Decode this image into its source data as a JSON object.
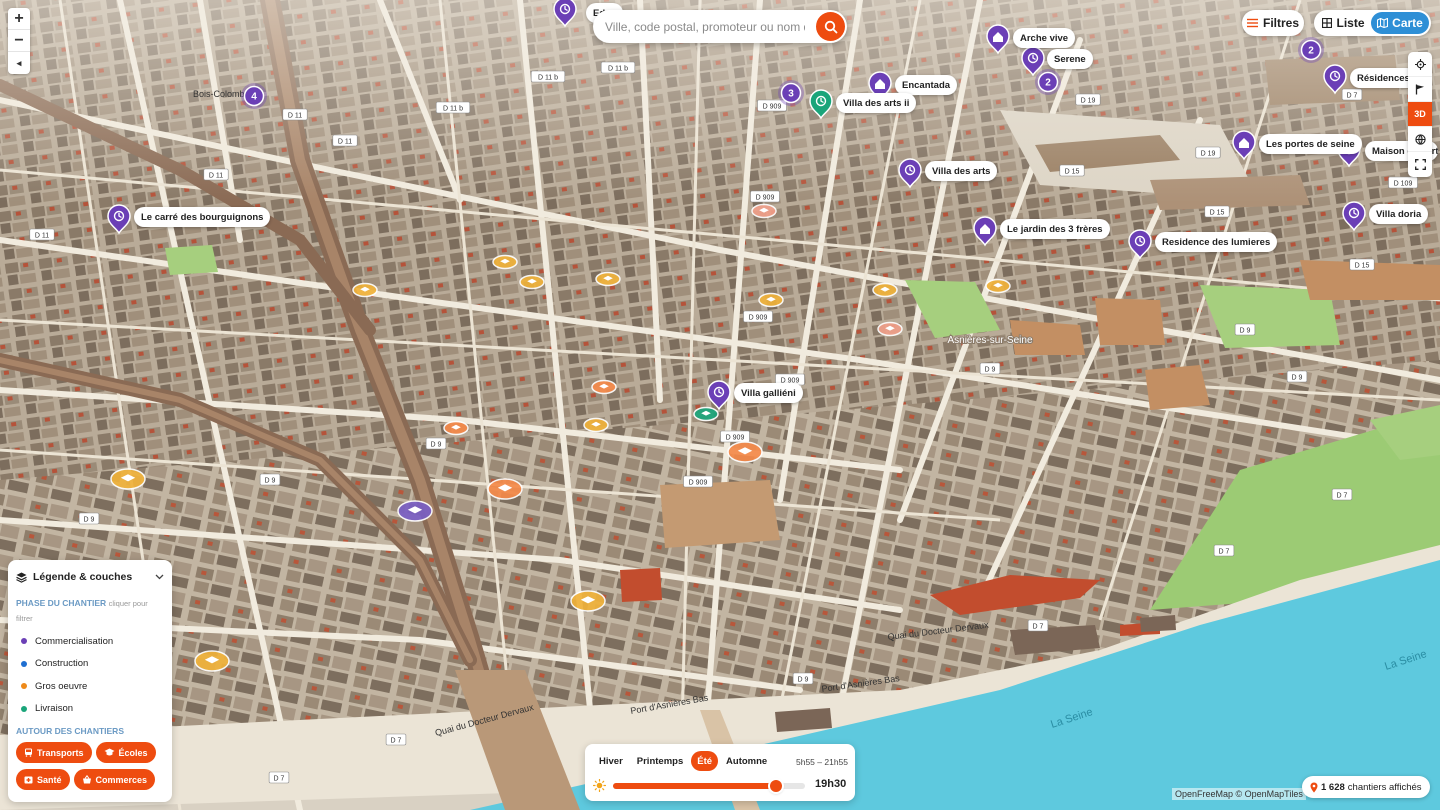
{
  "map": {
    "search_placeholder": "Ville, code postal, promoteur ou nom de chantier",
    "attribution": "OpenFreeMap © OpenMapTiles",
    "place_labels": [
      "Asnières-sur-Seine",
      "Bois-Colombes",
      "La Seine",
      "La Seine"
    ],
    "road_labels": [
      "D 11",
      "D 11",
      "D 11",
      "D 11",
      "D 11 b",
      "D 11 b",
      "D 909",
      "D 909",
      "D 909",
      "D 909",
      "D 909",
      "D 9",
      "D 9",
      "D 9",
      "D 9",
      "D 9",
      "D 7",
      "D 7",
      "D 7",
      "D 7",
      "D 7",
      "D 7",
      "D 15",
      "D 15",
      "D 15",
      "D 19",
      "D 19",
      "D 109",
      "Quai du Docteur Dervaux",
      "Quai du Docteur Dervaux",
      "Port d'Asnières Bas",
      "Port d'Asnières Bas"
    ],
    "pins": [
      {
        "label": "Eden",
        "color": "#6b3fb6",
        "icon": "clock-icon"
      },
      {
        "label": "Arche vive",
        "color": "#6b3fb6",
        "icon": "home-icon"
      },
      {
        "label": "Serene",
        "color": "#6b3fb6",
        "icon": "clock-icon"
      },
      {
        "label": "Encantada",
        "color": "#6b3fb6",
        "icon": "home-icon"
      },
      {
        "label": "Villa des arts ii",
        "color": "#1aa57a",
        "icon": "clock-icon"
      },
      {
        "label": "Résidences",
        "color": "#6b3fb6",
        "icon": "clock-icon"
      },
      {
        "label": "Les portes de seine",
        "color": "#6b3fb6",
        "icon": "home-icon"
      },
      {
        "label": "Maison des arts",
        "color": "#6b3fb6",
        "icon": "clock-icon"
      },
      {
        "label": "Villa des arts",
        "color": "#6b3fb6",
        "icon": "clock-icon"
      },
      {
        "label": "Le carré des bourguignons",
        "color": "#6b3fb6",
        "icon": "clock-icon"
      },
      {
        "label": "Le jardin des 3 frères",
        "color": "#6b3fb6",
        "icon": "home-icon"
      },
      {
        "label": "Residence des lumieres",
        "color": "#6b3fb6",
        "icon": "clock-icon"
      },
      {
        "label": "Villa doria",
        "color": "#6b3fb6",
        "icon": "clock-icon"
      },
      {
        "label": "Villa galliéni",
        "color": "#6b3fb6",
        "icon": "clock-icon"
      }
    ],
    "clusters": [
      "4",
      "3",
      "2",
      "2"
    ]
  },
  "controls": {
    "zoom_in": "+",
    "zoom_out": "−",
    "compass": "◂",
    "filters_label": "Filtres",
    "list_label": "Liste",
    "map_label": "Carte",
    "mode_3d_label": "3D"
  },
  "legend": {
    "title": "Légende & couches",
    "phase_title": "PHASE DU CHANTIER",
    "phase_hint": "cliquer pour filtrer",
    "phases": [
      {
        "label": "Commercialisation",
        "color": "#6b3fb6"
      },
      {
        "label": "Construction",
        "color": "#1f6fd1"
      },
      {
        "label": "Gros oeuvre",
        "color": "#ee8a1a"
      },
      {
        "label": "Livraison",
        "color": "#1aa57a"
      }
    ],
    "around_title": "AUTOUR DES CHANTIERS",
    "chips": [
      {
        "label": "Transports",
        "icon": "bus-icon"
      },
      {
        "label": "Écoles",
        "icon": "graduation-cap-icon"
      },
      {
        "label": "Santé",
        "icon": "medical-icon"
      },
      {
        "label": "Commerces",
        "icon": "basket-icon"
      }
    ]
  },
  "sun": {
    "seasons": [
      "Hiver",
      "Printemps",
      "Été",
      "Automne"
    ],
    "active_season": "Été",
    "range": "5h55 – 21h55",
    "time": "19h30",
    "progress": 0.85
  },
  "status": {
    "count": "1 628",
    "count_suffix": "chantiers affichés"
  },
  "colors": {
    "accent": "#ee4c10",
    "map_toggle": "#2e8fd6",
    "river": "#5ec9de",
    "park": "#a6cf7e",
    "pin_purple": "#6b3fb6",
    "pin_green": "#1aa57a"
  }
}
